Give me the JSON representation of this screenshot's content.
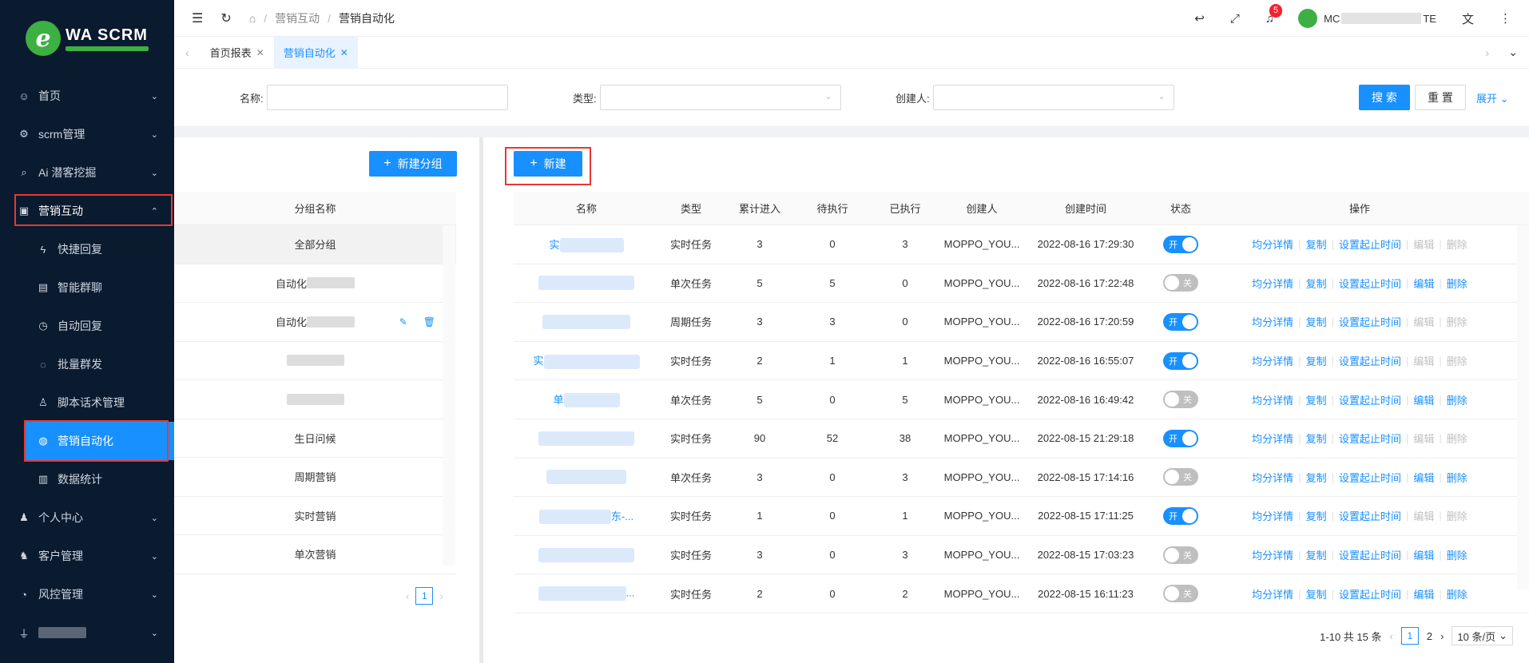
{
  "brand": {
    "logo_letter": "e",
    "title": "WA SCRM"
  },
  "sidebar": {
    "items": [
      {
        "icon": "smile-icon",
        "glyph": "☺",
        "label": "首页"
      },
      {
        "icon": "gear-icon",
        "glyph": "⚙",
        "label": "scrm管理"
      },
      {
        "icon": "search-icon",
        "glyph": "⌕",
        "label": "Ai 潜客挖掘"
      }
    ],
    "open_item": {
      "icon": "marketing-icon",
      "glyph": "▣",
      "label": "营销互动"
    },
    "subitems": [
      {
        "icon": "flash-icon",
        "glyph": "ϟ",
        "label": "快捷回复"
      },
      {
        "icon": "doc-icon",
        "glyph": "▤",
        "label": "智能群聊"
      },
      {
        "icon": "clock-icon",
        "glyph": "◷",
        "label": "自动回复"
      },
      {
        "icon": "chat-icon",
        "glyph": "◌",
        "label": "批量群发"
      },
      {
        "icon": "flow-icon",
        "glyph": "♙",
        "label": "脚本话术管理"
      }
    ],
    "active_sub": {
      "icon": "globe-icon",
      "glyph": "◍",
      "label": "营销自动化"
    },
    "after_sub": {
      "icon": "chart-icon",
      "glyph": "▥",
      "label": "数据统计"
    },
    "bottom_items": [
      {
        "icon": "user-icon",
        "glyph": "♟",
        "label": "个人中心"
      },
      {
        "icon": "team-icon",
        "glyph": "♞",
        "label": "客户管理"
      },
      {
        "icon": "dashboard-icon",
        "glyph": "◔",
        "label": "风控管理"
      }
    ]
  },
  "header": {
    "breadcrumb": [
      "营销互动",
      "营销自动化"
    ],
    "notification_count": "5",
    "user_prefix": "MC",
    "user_suffix": "TE"
  },
  "tabs": [
    {
      "label": "首页报表"
    },
    {
      "label": "营销自动化"
    }
  ],
  "search": {
    "name_label": "名称:",
    "type_label": "类型:",
    "creator_label": "创建人:",
    "search_button": "搜 索",
    "reset_button": "重 置",
    "expand_link": "展开"
  },
  "groups": {
    "new_group_button": "新建分组",
    "header": "分组名称",
    "rows": [
      {
        "label": "全部分组",
        "selected": true
      },
      {
        "label": "自动化"
      },
      {
        "label": "自动化"
      },
      {
        "label": ""
      },
      {
        "label": ""
      },
      {
        "label": "生日问候"
      },
      {
        "label": "周期营销"
      },
      {
        "label": "实时营销"
      },
      {
        "label": "单次营销"
      }
    ],
    "current_page": "1"
  },
  "tasks": {
    "new_button": "新建",
    "columns": [
      "名称",
      "类型",
      "累计进入",
      "待执行",
      "已执行",
      "创建人",
      "创建时间",
      "状态",
      "操作"
    ],
    "rows": [
      {
        "name": "实",
        "type": "实时任务",
        "entered": "3",
        "pending": "0",
        "done": "3",
        "creator": "MOPPO_YOU...",
        "time": "2022-08-16 17:29:30",
        "status": "开",
        "on": true
      },
      {
        "name": "",
        "type": "单次任务",
        "entered": "5",
        "pending": "5",
        "done": "0",
        "creator": "MOPPO_YOU...",
        "time": "2022-08-16 17:22:48",
        "status": "关",
        "on": false
      },
      {
        "name": "",
        "type": "周期任务",
        "entered": "3",
        "pending": "3",
        "done": "0",
        "creator": "MOPPO_YOU...",
        "time": "2022-08-16 17:20:59",
        "status": "开",
        "on": true
      },
      {
        "name": "实",
        "type": "实时任务",
        "entered": "2",
        "pending": "1",
        "done": "1",
        "creator": "MOPPO_YOU...",
        "time": "2022-08-16 16:55:07",
        "status": "开",
        "on": true
      },
      {
        "name": "单",
        "type": "单次任务",
        "entered": "5",
        "pending": "0",
        "done": "5",
        "creator": "MOPPO_YOU...",
        "time": "2022-08-16 16:49:42",
        "status": "关",
        "on": false
      },
      {
        "name": "",
        "type": "实时任务",
        "entered": "90",
        "pending": "52",
        "done": "38",
        "creator": "MOPPO_YOU...",
        "time": "2022-08-15 21:29:18",
        "status": "开",
        "on": true
      },
      {
        "name": "",
        "type": "单次任务",
        "entered": "3",
        "pending": "0",
        "done": "3",
        "creator": "MOPPO_YOU...",
        "time": "2022-08-15 17:14:16",
        "status": "关",
        "on": false
      },
      {
        "name": "东-...",
        "type": "实时任务",
        "entered": "1",
        "pending": "0",
        "done": "1",
        "creator": "MOPPO_YOU...",
        "time": "2022-08-15 17:11:25",
        "status": "开",
        "on": true
      },
      {
        "name": "",
        "type": "实时任务",
        "entered": "3",
        "pending": "0",
        "done": "3",
        "creator": "MOPPO_YOU...",
        "time": "2022-08-15 17:03:23",
        "status": "关",
        "on": false
      },
      {
        "name": "...",
        "type": "实时任务",
        "entered": "2",
        "pending": "0",
        "done": "2",
        "creator": "MOPPO_YOU...",
        "time": "2022-08-15 16:11:23",
        "status": "关",
        "on": false
      }
    ],
    "ops": [
      "均分详情",
      "复制",
      "设置起止时间",
      "编辑",
      "删除"
    ],
    "pagination": {
      "summary": "1-10 共 15 条",
      "pages": [
        "1",
        "2"
      ],
      "current": "1",
      "page_size": "10 条/页"
    }
  }
}
